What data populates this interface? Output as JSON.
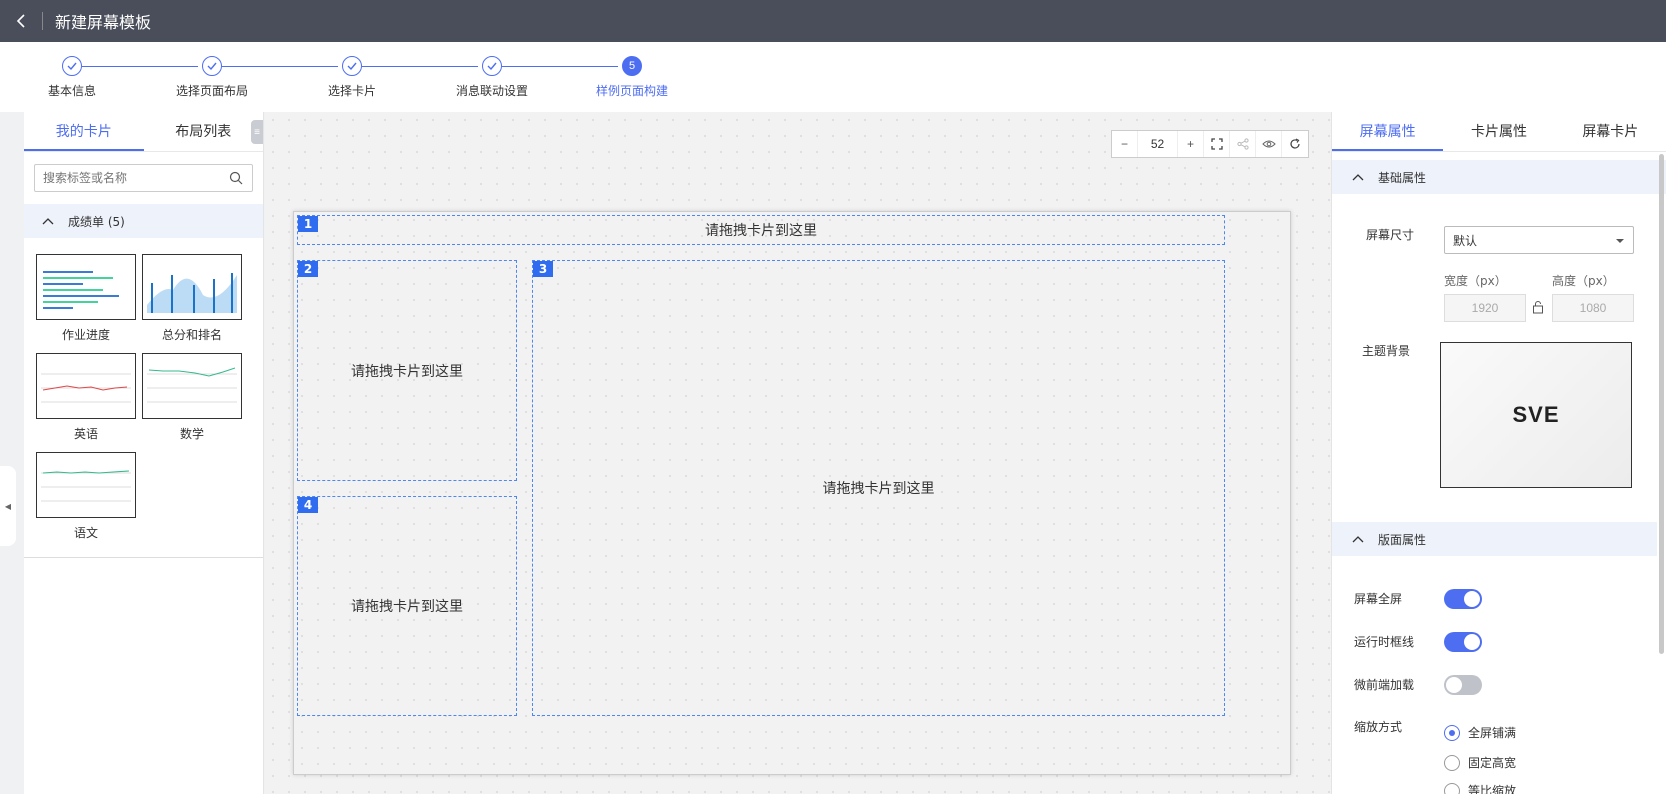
{
  "header": {
    "title": "新建屏幕模板"
  },
  "steps": [
    {
      "label": "基本信息",
      "state": "done",
      "number": ""
    },
    {
      "label": "选择页面布局",
      "state": "done",
      "number": ""
    },
    {
      "label": "选择卡片",
      "state": "done",
      "number": ""
    },
    {
      "label": "消息联动设置",
      "state": "done",
      "number": ""
    },
    {
      "label": "样例页面构建",
      "state": "active",
      "number": "5"
    }
  ],
  "left_panel": {
    "tabs": [
      "我的卡片",
      "布局列表"
    ],
    "search_placeholder": "搜索标签或名称",
    "group": {
      "label": "成绩单 (5)"
    },
    "cards": [
      "作业进度",
      "总分和排名",
      "英语",
      "数学",
      "语文"
    ]
  },
  "toolbar": {
    "zoom": "52",
    "minus": "−",
    "plus": "+"
  },
  "canvas": {
    "slots": [
      {
        "num": "1",
        "text": "请拖拽卡片到这里"
      },
      {
        "num": "2",
        "text": "请拖拽卡片到这里"
      },
      {
        "num": "3",
        "text": "请拖拽卡片到这里"
      },
      {
        "num": "4",
        "text": "请拖拽卡片到这里"
      }
    ]
  },
  "right_panel": {
    "tabs": [
      "屏幕属性",
      "卡片属性",
      "屏幕卡片"
    ],
    "basic_section": "基础属性",
    "screen_size_label": "屏幕尺寸",
    "screen_size_value": "默认",
    "width_label": "宽度（px）",
    "height_label": "高度（px）",
    "width_value": "1920",
    "height_value": "1080",
    "theme_label": "主题背景",
    "theme_logo": "SVE",
    "layout_section": "版面属性",
    "fullscreen_label": "屏幕全屏",
    "fullscreen_on": true,
    "runtime_border_label": "运行时框线",
    "runtime_border_on": true,
    "micro_frontend_label": "微前端加载",
    "micro_frontend_on": false,
    "scale_label": "缩放方式",
    "scale_options": [
      "全屏铺满",
      "固定高宽",
      "等比缩放"
    ],
    "scale_selected": 0
  },
  "colors": {
    "accent": "#4e6ef2",
    "topbar": "#4a4e5a",
    "slot_border": "#4e86f2"
  }
}
